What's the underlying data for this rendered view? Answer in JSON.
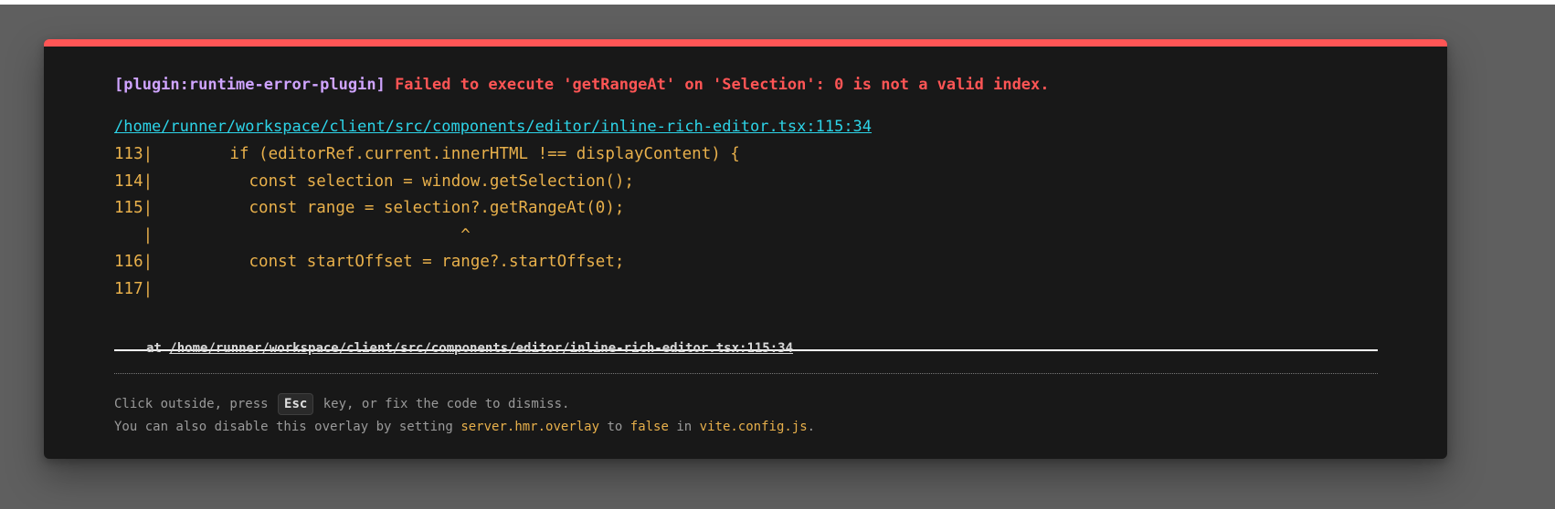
{
  "overlay": {
    "plugin_label": "[plugin:runtime-error-plugin]",
    "message": "Failed to execute 'getRangeAt' on 'Selection': 0 is not a valid index.",
    "file": "/home/runner/workspace/client/src/components/editor/inline-rich-editor.tsx:115:34",
    "code_lines": [
      "113|        if (editorRef.current.innerHTML !== displayContent) {",
      "114|          const selection = window.getSelection();",
      "115|          const range = selection?.getRangeAt(0);",
      "   |                                ^",
      "116|          const startOffset = range?.startOffset;",
      "117|"
    ],
    "stack_prefix": "at",
    "stack_file": "/home/runner/workspace/client/src/components/editor/inline-rich-editor.tsx:115:34",
    "tip_line1": {
      "before": "Click outside, press",
      "key": "Esc",
      "after": "key, or fix the code to dismiss."
    },
    "tip_line2": {
      "part1": "You can also disable this overlay by setting",
      "setting": "server.hmr.overlay",
      "part2": "to",
      "value": "false",
      "part3": "in",
      "config_file": "vite.config.js",
      "part4": "."
    }
  },
  "colors": {
    "backdrop": "#5f5f5f",
    "card_background": "#181818",
    "accent_bar": "#ff5555",
    "plugin_color": "#cfa4ff",
    "message_color": "#ff5555",
    "file_link_color": "#2dd4e8",
    "code_color": "#e8b04b"
  },
  "icons": {
    "scroll_left": "triangle-left-icon",
    "scroll_right": "triangle-right-icon"
  }
}
